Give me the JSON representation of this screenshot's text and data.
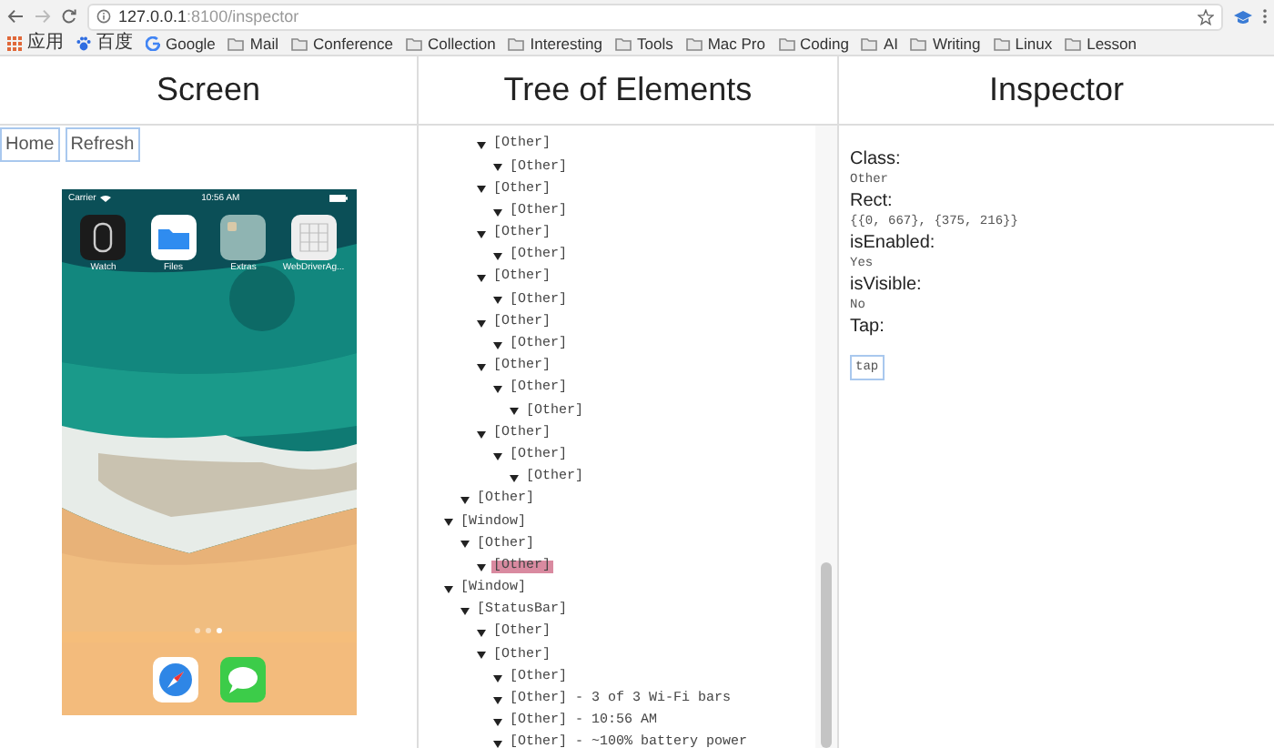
{
  "browser": {
    "url_host": "127.0.0.1",
    "url_rest": ":8100/inspector",
    "bookmarks": [
      {
        "kind": "apps",
        "label": "应用"
      },
      {
        "kind": "paw",
        "label": "百度"
      },
      {
        "kind": "google",
        "label": "Google"
      },
      {
        "kind": "folder",
        "label": "Mail"
      },
      {
        "kind": "folder",
        "label": "Conference"
      },
      {
        "kind": "folder",
        "label": "Collection"
      },
      {
        "kind": "folder",
        "label": "Interesting"
      },
      {
        "kind": "folder",
        "label": "Tools"
      },
      {
        "kind": "folder",
        "label": "Mac Pro"
      },
      {
        "kind": "folder",
        "label": "Coding"
      },
      {
        "kind": "folder",
        "label": "AI"
      },
      {
        "kind": "folder",
        "label": "Writing"
      },
      {
        "kind": "folder",
        "label": "Linux"
      },
      {
        "kind": "folder",
        "label": "Lesson"
      }
    ]
  },
  "screen": {
    "title": "Screen",
    "buttons": [
      "Home",
      "Refresh"
    ],
    "device": {
      "carrier": "Carrier",
      "time": "10:56 AM",
      "apps": [
        {
          "kind": "watch",
          "label": "Watch"
        },
        {
          "kind": "files",
          "label": "Files"
        },
        {
          "kind": "folder",
          "label": "Extras"
        },
        {
          "kind": "grid",
          "label": "WebDriverAg..."
        }
      ],
      "pages": [
        {
          "selected": false
        },
        {
          "selected": false
        },
        {
          "selected": true
        }
      ],
      "dock": [
        {
          "kind": "compass"
        },
        {
          "kind": "messages"
        }
      ]
    }
  },
  "tree": {
    "title": "Tree of Elements",
    "nodes": [
      {
        "children": [
          {
            "children": [
              {
                "label": "[Other]",
                "selected": false,
                "children": [
                  {
                    "label": "[Other]",
                    "selected": false
                  }
                ]
              },
              {
                "label": "[Other]",
                "selected": false,
                "children": [
                  {
                    "label": "[Other]",
                    "selected": false
                  }
                ]
              },
              {
                "label": "[Other]",
                "selected": false,
                "children": [
                  {
                    "label": "[Other]",
                    "selected": false
                  }
                ]
              },
              {
                "label": "[Other]",
                "selected": false,
                "children": [
                  {
                    "label": "[Other]",
                    "selected": false
                  }
                ]
              },
              {
                "label": "[Other]",
                "selected": false,
                "children": [
                  {
                    "label": "[Other]",
                    "selected": false
                  }
                ]
              },
              {
                "label": "[Other]",
                "selected": false,
                "children": [
                  {
                    "label": "[Other]",
                    "selected": false,
                    "children": [
                      {
                        "label": "[Other]",
                        "selected": false
                      }
                    ]
                  }
                ]
              },
              {
                "label": "[Other]",
                "selected": false,
                "children": [
                  {
                    "label": "[Other]",
                    "selected": false,
                    "children": [
                      {
                        "label": "[Other]",
                        "selected": false
                      }
                    ]
                  }
                ]
              }
            ]
          },
          {
            "label": "[Other]",
            "selected": false
          }
        ]
      },
      {
        "label": "[Window]",
        "selected": false,
        "children": [
          {
            "label": "[Other]",
            "selected": false,
            "children": [
              {
                "label": "[Other]",
                "selected": true
              }
            ]
          }
        ]
      },
      {
        "label": "[Window]",
        "selected": false,
        "children": [
          {
            "label": "[StatusBar]",
            "selected": false,
            "children": [
              {
                "label": "[Other]",
                "selected": false
              },
              {
                "label": "[Other]",
                "selected": false,
                "children": [
                  {
                    "label": "[Other]",
                    "selected": false
                  },
                  {
                    "label": "[Other] - 3 of 3 Wi-Fi bars",
                    "selected": false
                  },
                  {
                    "label": "[Other] - 10:56 AM",
                    "selected": false
                  },
                  {
                    "label": "[Other] - ~100% battery power",
                    "selected": false
                  }
                ]
              }
            ]
          }
        ]
      }
    ]
  },
  "inspector": {
    "title": "Inspector",
    "fields": [
      {
        "kind": "text",
        "label": "Class:",
        "value": "Other"
      },
      {
        "kind": "text",
        "label": "Rect:",
        "value": "{{0, 667}, {375, 216}}"
      },
      {
        "kind": "text",
        "label": "isEnabled:",
        "value": "Yes"
      },
      {
        "kind": "text",
        "label": "isVisible:",
        "value": "No"
      },
      {
        "kind": "action",
        "label": "Tap:",
        "value": "tap"
      }
    ]
  }
}
